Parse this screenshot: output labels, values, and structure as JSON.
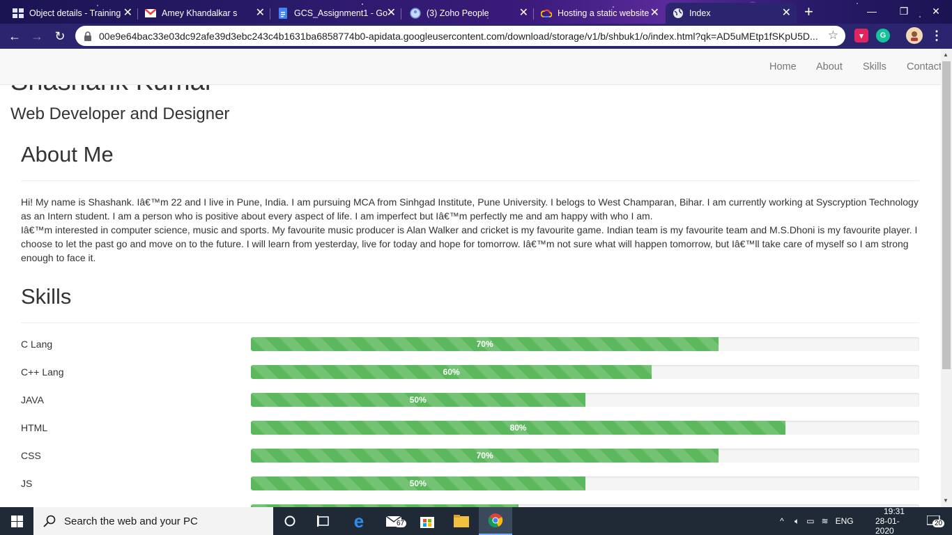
{
  "browser": {
    "tabs": [
      {
        "title": "Object details - Training",
        "icon": "grid-icon"
      },
      {
        "title": "Amey Khandalkar s",
        "icon": "gmail-icon"
      },
      {
        "title": "GCS_Assignment1 - Go",
        "icon": "docs-icon"
      },
      {
        "title": "(3) Zoho People",
        "icon": "zoho-icon"
      },
      {
        "title": "Hosting a static website",
        "icon": "cloud-icon"
      },
      {
        "title": "Index",
        "icon": "globe-icon"
      }
    ],
    "url": "00e9e64bac33e03dc92afe39d3ebc243c4b1631ba6858774b0-apidata.googleusercontent.com/download/storage/v1/b/shbuk1/o/index.html?qk=AD5uMEtp1fSKpU5D...",
    "colors": {
      "frame": "#2b246e",
      "accent": "#5cb85c"
    }
  },
  "page": {
    "nav": [
      "Home",
      "About",
      "Skills",
      "Contact"
    ],
    "hero_name": "Shashank Kumar",
    "hero_subtitle": "Web Developer and Designer",
    "about": {
      "heading": "About Me",
      "paragraph1": "Hi! My name is Shashank. Iâ€™m 22 and I live in Pune, India. I am pursuing MCA from Sinhgad Institute, Pune University. I belogs to West Champaran, Bihar. I am currently working at Syscryption Technology as an Intern student. I am a person who is positive about every aspect of life. I am imperfect but Iâ€™m perfectly me and am happy with who I am.",
      "paragraph2": "Iâ€™m interested in computer science, music and sports. My favourite music producer is Alan Walker and cricket is my favourite game. Indian team is my favourite team and M.S.Dhoni is my favourite player. I choose to let the past go and move on to the future. I will learn from yesterday, live for today and hope for tomorrow. Iâ€™m not sure what will happen tomorrow, but Iâ€™ll take care of myself so I am strong enough to face it."
    },
    "skills": {
      "heading": "Skills",
      "items": [
        {
          "name": "C Lang",
          "percent": 70,
          "label": "70%"
        },
        {
          "name": "C++ Lang",
          "percent": 60,
          "label": "60%"
        },
        {
          "name": "JAVA",
          "percent": 50,
          "label": "50%"
        },
        {
          "name": "HTML",
          "percent": 80,
          "label": "80%"
        },
        {
          "name": "CSS",
          "percent": 70,
          "label": "70%"
        },
        {
          "name": "JS",
          "percent": 50,
          "label": "50%"
        },
        {
          "name": "",
          "percent": 40,
          "label": ""
        }
      ]
    }
  },
  "taskbar": {
    "search_placeholder": "Search the web and your PC",
    "mail_badge": "67",
    "language": "ENG",
    "time": "19:31",
    "date": "28-01-2020",
    "notification_count": "20"
  }
}
